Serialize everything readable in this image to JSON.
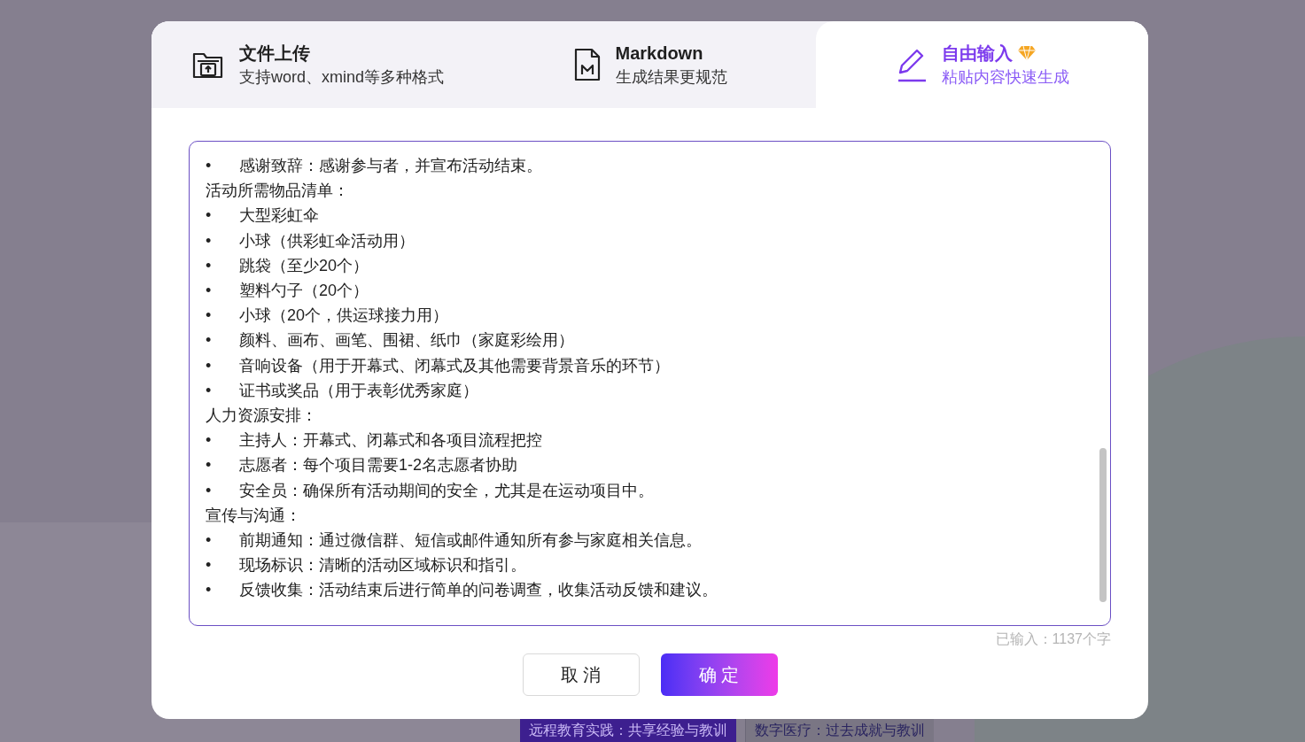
{
  "tabs": [
    {
      "kind": "upload",
      "title": "文件上传",
      "subtitle": "支持word、xmind等多种格式",
      "selected": false,
      "premium": false
    },
    {
      "kind": "markdown",
      "title": "Markdown",
      "subtitle": "生成结果更规范",
      "selected": false,
      "premium": false
    },
    {
      "kind": "free",
      "title": "自由输入",
      "subtitle": "粘贴内容快速生成",
      "selected": true,
      "premium": true
    }
  ],
  "editor": {
    "lines": [
      {
        "kind": "bullet",
        "text": "感谢致辞：感谢参与者，并宣布活动结束。"
      },
      {
        "kind": "heading",
        "text": "活动所需物品清单："
      },
      {
        "kind": "bullet",
        "text": "大型彩虹伞"
      },
      {
        "kind": "bullet",
        "text": "小球（供彩虹伞活动用）"
      },
      {
        "kind": "bullet",
        "text": "跳袋（至少20个）"
      },
      {
        "kind": "bullet",
        "text": "塑料勺子（20个）"
      },
      {
        "kind": "bullet",
        "text": "小球（20个，供运球接力用）"
      },
      {
        "kind": "bullet",
        "text": "颜料、画布、画笔、围裙、纸巾（家庭彩绘用）"
      },
      {
        "kind": "bullet",
        "text": "音响设备（用于开幕式、闭幕式及其他需要背景音乐的环节）"
      },
      {
        "kind": "bullet",
        "text": "证书或奖品（用于表彰优秀家庭）"
      },
      {
        "kind": "heading",
        "text": "人力资源安排："
      },
      {
        "kind": "bullet",
        "text": "主持人：开幕式、闭幕式和各项目流程把控"
      },
      {
        "kind": "bullet",
        "text": "志愿者：每个项目需要1-2名志愿者协助"
      },
      {
        "kind": "bullet",
        "text": "安全员：确保所有活动期间的安全，尤其是在运动项目中。"
      },
      {
        "kind": "heading",
        "text": "宣传与沟通："
      },
      {
        "kind": "bullet",
        "text": "前期通知：通过微信群、短信或邮件通知所有参与家庭相关信息。"
      },
      {
        "kind": "bullet",
        "text": "现场标识：清晰的活动区域标识和指引。"
      },
      {
        "kind": "bullet",
        "text": "反馈收集：活动结束后进行简单的问卷调查，收集活动反馈和建议。"
      }
    ],
    "bullet": "•",
    "counter": "已输入：1137个字"
  },
  "buttons": [
    {
      "kind": "secondary",
      "label": "取 消"
    },
    {
      "kind": "primary",
      "label": "确 定"
    }
  ],
  "background_tags": [
    {
      "label": "远程教育实践：共享经验与教训",
      "selected": true
    },
    {
      "label": "数字医疗：过去成就与教训",
      "selected": false
    }
  ]
}
